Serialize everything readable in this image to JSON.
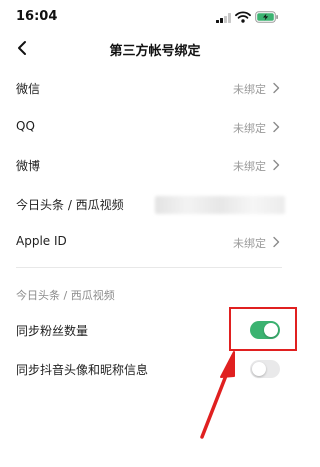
{
  "status_bar": {
    "time": "16:04"
  },
  "nav": {
    "title": "第三方帐号绑定"
  },
  "accounts": [
    {
      "label": "微信",
      "status": "未绑定"
    },
    {
      "label": "QQ",
      "status": "未绑定"
    },
    {
      "label": "微博",
      "status": "未绑定"
    },
    {
      "label": "今日头条 / 西瓜视频",
      "status": ""
    },
    {
      "label": "Apple ID",
      "status": "未绑定"
    }
  ],
  "sync_section": {
    "title": "今日头条 / 西瓜视频",
    "items": [
      {
        "label": "同步粉丝数量",
        "enabled": true
      },
      {
        "label": "同步抖音头像和昵称信息",
        "enabled": false
      }
    ]
  },
  "colors": {
    "toggle_on": "#3bb371",
    "annotation": "#e02020"
  }
}
